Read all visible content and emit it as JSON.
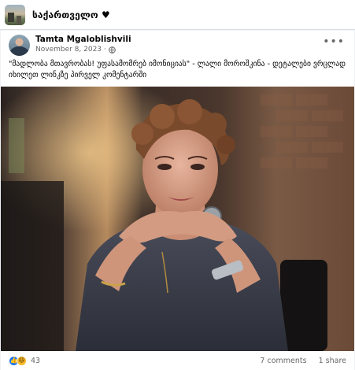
{
  "group": {
    "name": "საქართველო ♥"
  },
  "post": {
    "author": "Tamta Mgaloblishvili",
    "date": "November 8, 2023 ·",
    "privacy_icon": "globe-icon",
    "menu_icon": "more-options-icon",
    "caption": "\"მადლობა მთავრობას! უფასამომრებ იმონიციას\" - ლალი მოროშკინა - დეტალები ვრცლად იხილეთ ლინკზე პირველ კომენტარში",
    "image_icon": "woman-portrait-photo",
    "reactions": {
      "types": [
        "like-icon",
        "haha-icon"
      ],
      "count": "43"
    },
    "comments": "7 comments",
    "shares": "1 share"
  },
  "colors": {
    "background": "#f0f2f5",
    "card": "#ffffff",
    "secondary_text": "#65676b",
    "like_blue": "#1877f2",
    "haha_yellow": "#f7b928"
  }
}
